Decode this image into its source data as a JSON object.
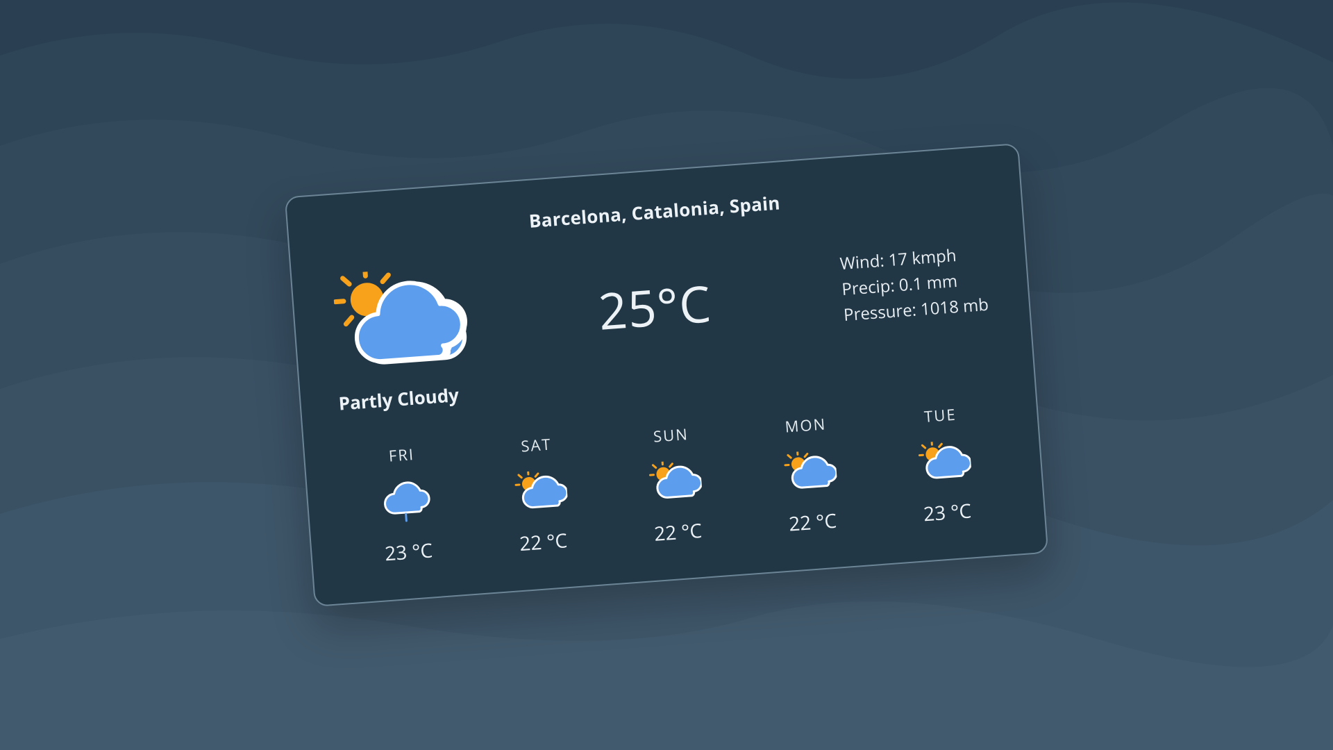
{
  "location": "Barcelona, Catalonia, Spain",
  "current": {
    "condition": "Partly Cloudy",
    "temperature": "25°C",
    "wind": "Wind: 17 kmph",
    "precip": "Precip: 0.1 mm",
    "pressure": "Pressure: 1018 mb",
    "icon": "partly-cloudy"
  },
  "forecast": [
    {
      "day": "FRI",
      "temp": "23 °C",
      "icon": "drizzle"
    },
    {
      "day": "SAT",
      "temp": "22 °C",
      "icon": "partly-cloudy"
    },
    {
      "day": "SUN",
      "temp": "22 °C",
      "icon": "partly-cloudy"
    },
    {
      "day": "MON",
      "temp": "22 °C",
      "icon": "partly-cloudy"
    },
    {
      "day": "TUE",
      "temp": "23 °C",
      "icon": "partly-cloudy"
    }
  ],
  "colors": {
    "card_bg": "#213746",
    "card_border": "#6c8596",
    "sun": "#f8a11a",
    "cloud": "#5c9ded",
    "cloud_stroke": "#ffffff"
  }
}
